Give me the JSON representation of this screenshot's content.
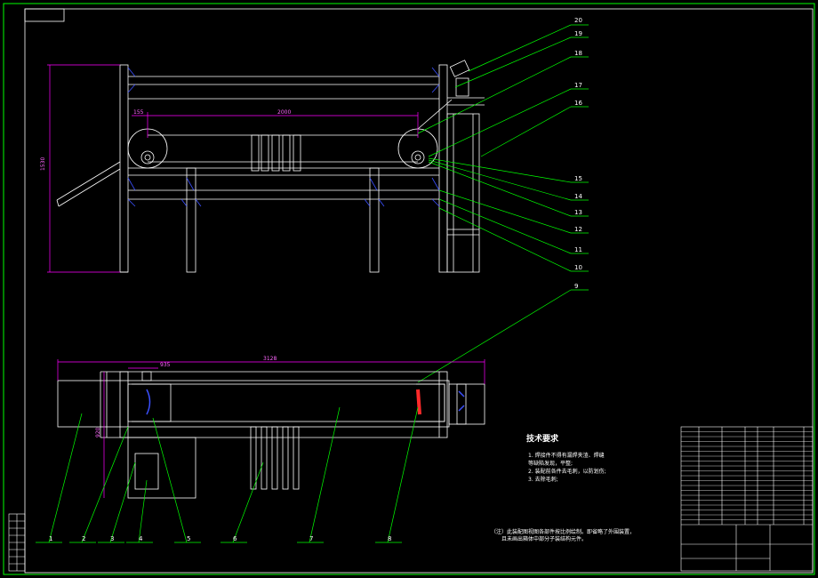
{
  "drawing": {
    "balloons_top": [
      "20",
      "19",
      "18",
      "17",
      "16",
      "15",
      "14",
      "13",
      "12",
      "11",
      "10"
    ],
    "balloon_9": "9",
    "balloons_bottom": [
      "1",
      "2",
      "3",
      "4",
      "5",
      "6",
      "7",
      "8"
    ],
    "dims": {
      "height_top": "1530",
      "d155": "155",
      "d2000": "2000",
      "d3128": "3128",
      "d935": "935",
      "d920": "920"
    },
    "tech_title": "技术要求",
    "tech_items": [
      "1.  焊接件不得有漏焊夹渣、焊缝",
      "    等缺陷发现，平整;",
      "2.  装配前各件去毛刺，以防划伤;",
      "3.  去除毛刺;"
    ],
    "note_text": "（注）此装配图视图各部件按比例绘制。即省略了外围装置，",
    "note_text2": "且未画出箱体中部分子装结构元件。"
  },
  "colors": {
    "frame": "#00ff00",
    "line": "#ffffff",
    "dim": "#ff00ff",
    "leader": "#00ff00",
    "fixture": "#3b50ff",
    "accent": "#ff2a2a"
  }
}
